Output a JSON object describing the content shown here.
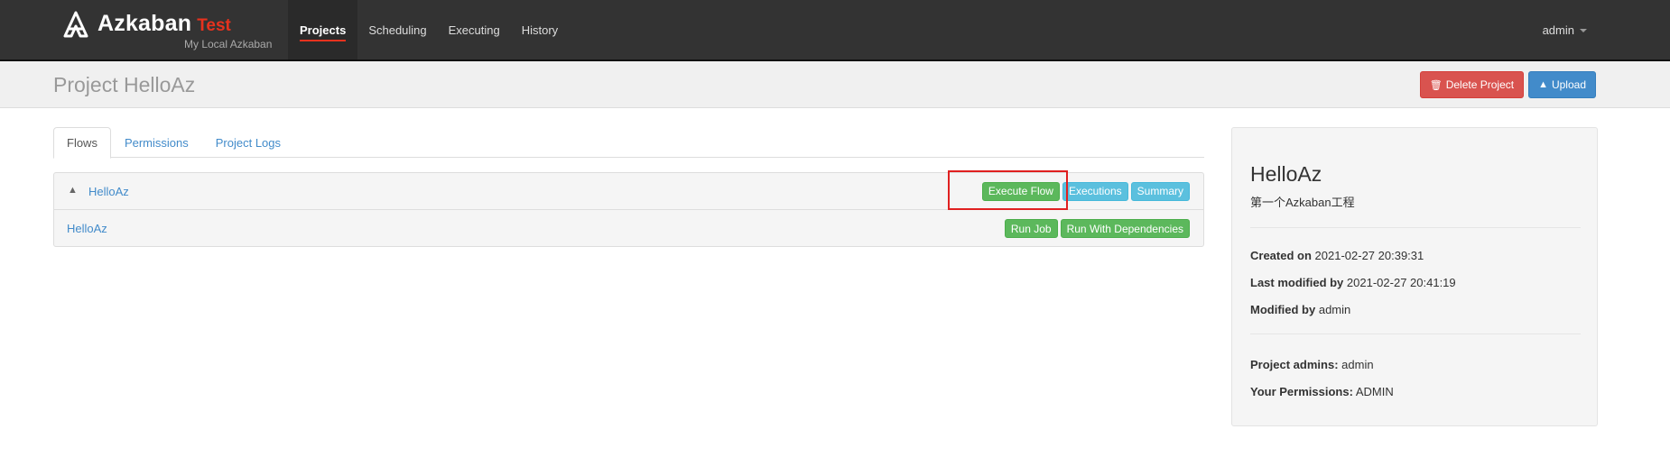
{
  "navbar": {
    "brand_name": "Azkaban",
    "brand_env": "Test",
    "brand_sub": "My Local Azkaban",
    "items": [
      {
        "label": "Projects",
        "active": true
      },
      {
        "label": "Scheduling"
      },
      {
        "label": "Executing"
      },
      {
        "label": "History"
      }
    ],
    "user": "admin"
  },
  "header": {
    "title": "Project HelloAz",
    "delete_label": "Delete Project",
    "upload_label": "Upload"
  },
  "tabs": [
    {
      "label": "Flows",
      "active": true
    },
    {
      "label": "Permissions"
    },
    {
      "label": "Project Logs"
    }
  ],
  "flow": {
    "name": "HelloAz",
    "execute_label": "Execute Flow",
    "executions_label": "Executions",
    "summary_label": "Summary",
    "job": {
      "name": "HelloAz",
      "run_job_label": "Run Job",
      "run_deps_label": "Run With Dependencies"
    }
  },
  "project_info": {
    "name": "HelloAz",
    "description": "第一个Azkaban工程",
    "created_on_label": "Created on",
    "created_on": "2021-02-27 20:39:31",
    "last_modified_label": "Last modified by",
    "last_modified": "2021-02-27 20:41:19",
    "modified_by_label": "Modified by",
    "modified_by": "admin",
    "admins_label": "Project admins:",
    "admins": "admin",
    "permissions_label": "Your Permissions:",
    "permissions": "ADMIN"
  },
  "colors": {
    "navbar_bg": "#333333",
    "accent_red": "#e7321e",
    "link_blue": "#428bca",
    "success_green": "#5cb85c",
    "info_cyan": "#5bc0de",
    "danger_red": "#d9534f"
  }
}
